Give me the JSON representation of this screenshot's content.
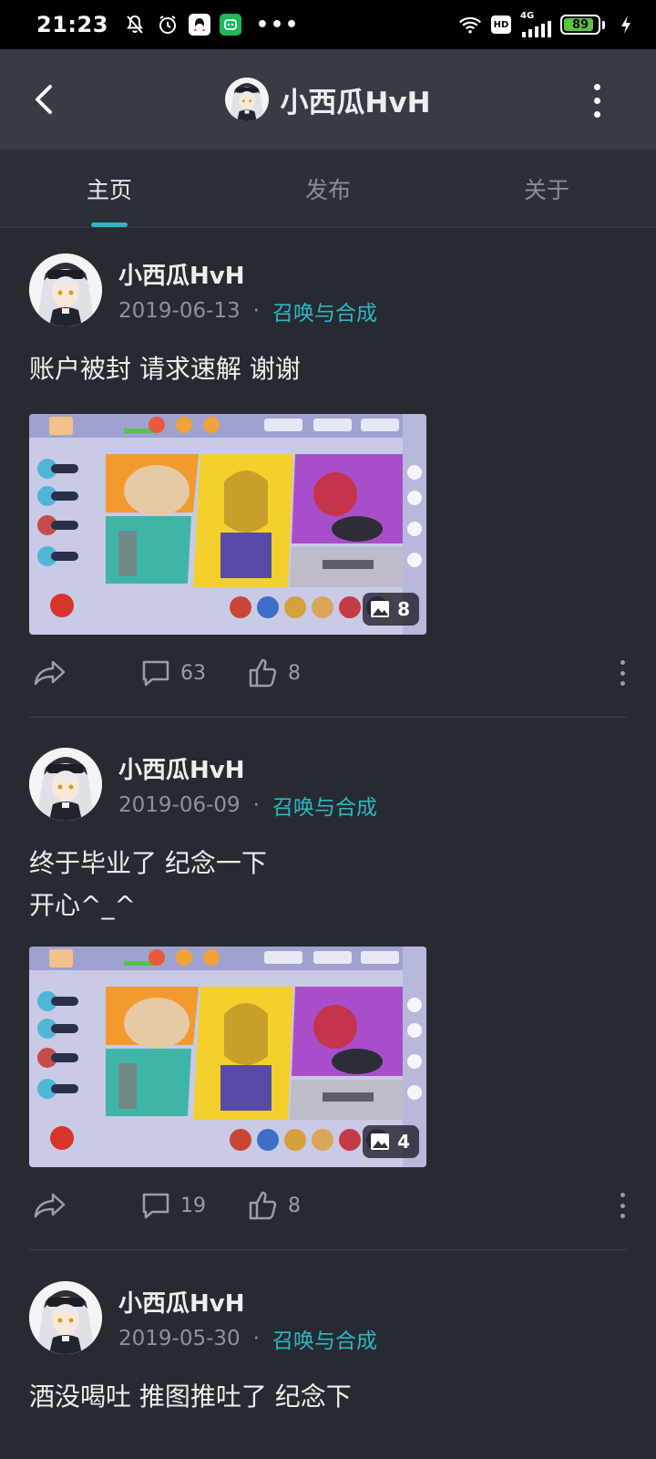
{
  "status": {
    "time": "21:23",
    "network": "4G",
    "hd": "HD",
    "battery": "89",
    "battery_level": 0.89,
    "more": "•••"
  },
  "header": {
    "title": "小西瓜HvH"
  },
  "tabs": [
    {
      "label": "主页",
      "active": true
    },
    {
      "label": "发布",
      "active": false
    },
    {
      "label": "关于",
      "active": false
    }
  ],
  "posts": [
    {
      "author": "小西瓜HvH",
      "date": "2019-06-13",
      "separator": "·",
      "tag": "召唤与合成",
      "text_lines": [
        "账户被封 请求速解 谢谢"
      ],
      "image_count": "8",
      "comments": "63",
      "likes": "8"
    },
    {
      "author": "小西瓜HvH",
      "date": "2019-06-09",
      "separator": "·",
      "tag": "召唤与合成",
      "text_lines": [
        "终于毕业了 纪念一下",
        "开心^_^"
      ],
      "image_count": "4",
      "comments": "19",
      "likes": "8"
    },
    {
      "author": "小西瓜HvH",
      "date": "2019-05-30",
      "separator": "·",
      "tag": "召唤与合成",
      "text_lines": [
        "酒没喝吐 推图推吐了 纪念下"
      ]
    }
  ],
  "colors": {
    "accent": "#2bb8c5",
    "background": "#272a31",
    "header": "#363b44"
  }
}
